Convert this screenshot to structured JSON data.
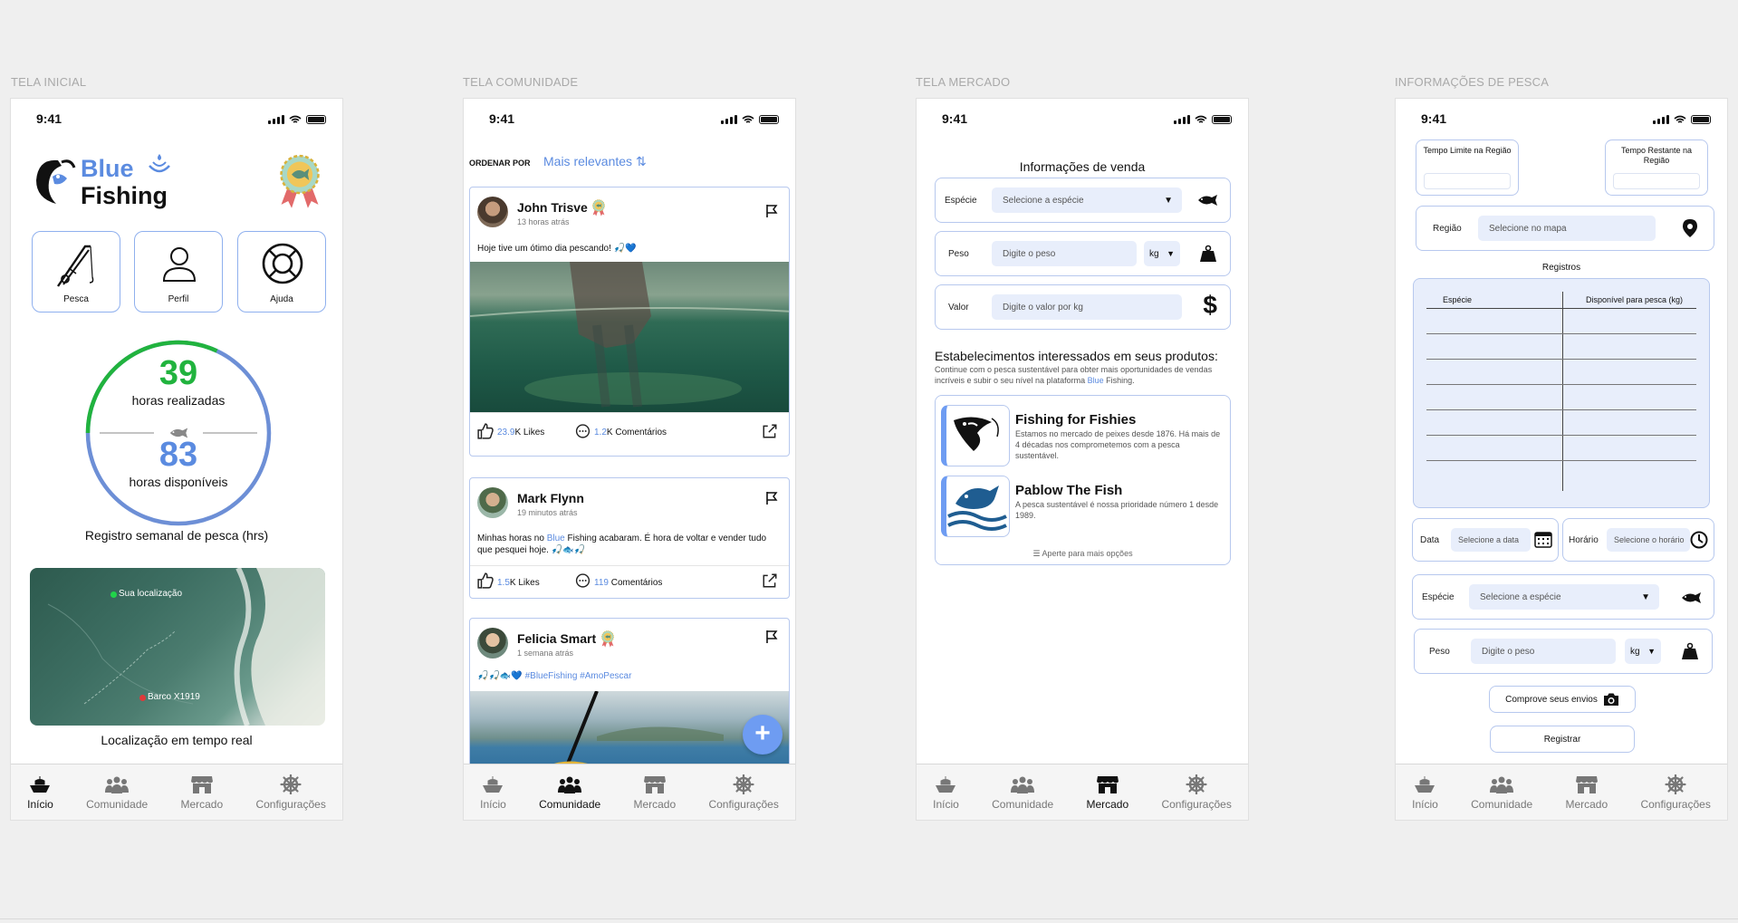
{
  "labels": {
    "home": "TELA INICIAL",
    "community": "TELA COMUNIDADE",
    "market": "TELA MERCADO",
    "fishing": "INFORMAÇÕES DE PESCA"
  },
  "status_time": "9:41",
  "tabs": {
    "home": "Início",
    "community": "Comunidade",
    "market": "Mercado",
    "settings": "Configurações"
  },
  "home": {
    "logo_blue": "Blue",
    "logo_fishing": "Fishing",
    "buttons": [
      "Pesca",
      "Perfil",
      "Ajuda"
    ],
    "hours_done": "39",
    "hours_done_label": "horas realizadas",
    "hours_avail": "83",
    "hours_avail_label": "horas disponíveis",
    "progress_fraction": 0.32,
    "chart_caption": "Registro semanal de pesca (hrs)",
    "map_you": "Sua localização",
    "map_boat": "Barco X1919",
    "map_caption": "Localização em tempo real"
  },
  "community": {
    "sort_label": "ORDENAR POR",
    "sort_value": "Mais relevantes",
    "posts": [
      {
        "name": "John Trisve",
        "time": "13 horas atrás",
        "text": "Hoje tive um ótimo dia pescando! 🎣💙",
        "likes_num": "23.9",
        "likes_rest": "K Likes",
        "comments_num": "1.2",
        "comments_rest": "K Comentários"
      },
      {
        "name": "Mark Flynn",
        "time": "19 minutos atrás",
        "text_a": "Minhas horas no ",
        "text_b": "Blue",
        "text_c": " Fishing acabaram. É hora de voltar e vender tudo que pesquei hoje. 🎣🐟🎣",
        "likes_num": "1.5",
        "likes_rest": "K Likes",
        "comments_num": "119",
        "comments_rest": " Comentários"
      },
      {
        "name": "Felicia Smart",
        "time": "1 semana atrás",
        "emoji": "🎣🎣🐟💙",
        "tag1": "#BlueFishing",
        "tag2": "#AmoPescar"
      }
    ]
  },
  "market": {
    "title": "Informações de venda",
    "species_label": "Espécie",
    "species_ph": "Selecione a espécie",
    "weight_label": "Peso",
    "weight_ph": "Digite o peso",
    "unit": "kg",
    "value_label": "Valor",
    "value_ph": "Digite o valor por kg",
    "interested_title": "Estabelecimentos interessados em seus produtos:",
    "interested_sub_a": "Continue com o pesca sustentável para obter mais oportunidades de vendas incríveis e subir o seu nível na plataforma ",
    "interested_sub_b": "Blue",
    "interested_sub_c": " Fishing.",
    "shops": [
      {
        "name": "Fishing for Fishies",
        "desc": "Estamos no mercado de peixes desde 1876. Há mais de 4 décadas nos comprometemos com a pesca sustentável."
      },
      {
        "name": "Pablow The Fish",
        "desc": "A pesca sustentável é nossa prioridade número 1 desde 1989."
      }
    ],
    "more": "Aperte para mais opções"
  },
  "fishing": {
    "time_limit": "Tempo Limite na Região",
    "time_left": "Tempo Restante na Região",
    "region_label": "Região",
    "region_ph": "Selecione no mapa",
    "records_title": "Registros",
    "col_species": "Espécie",
    "col_avail": "Disponível para pesca (kg)",
    "date_label": "Data",
    "date_ph": "Selecione a data",
    "time_label": "Horário",
    "time_ph": "Selecione o horário",
    "species_label": "Espécie",
    "species_ph": "Selecione a espécie",
    "weight_label": "Peso",
    "weight_ph": "Digite o peso",
    "unit": "kg",
    "proof_button": "Comprove seus envios",
    "submit_button": "Registrar"
  },
  "colors": {
    "accent": "#5b8be0",
    "green": "#21b33e",
    "field_border": "#b7c8ee",
    "field_bg": "#e8eefb"
  }
}
